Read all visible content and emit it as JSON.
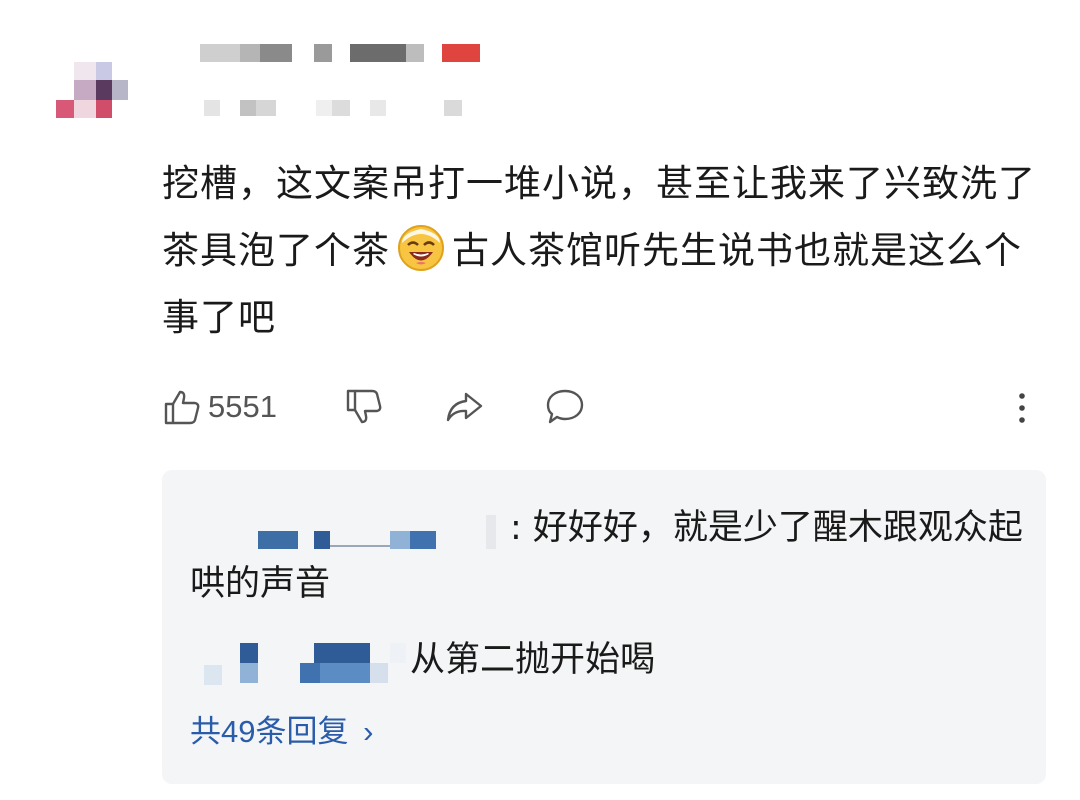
{
  "comment": {
    "text_before_emoji": "挖槽，这文案吊打一堆小说，甚至让我来了兴致洗了茶具泡了个茶",
    "emoji_icon": "laughing-face-emoji",
    "text_after_emoji": "古人茶馆听先生说书也就是这么个事了吧"
  },
  "actions": {
    "like_count": "5551",
    "icons": [
      "thumbs-up-icon",
      "thumbs-down-icon",
      "share-icon",
      "reply-bubble-icon",
      "more-dots-icon"
    ]
  },
  "replies": [
    {
      "separator": ": ",
      "text": "好好好，就是少了醒木跟观众起哄的声音"
    },
    {
      "text": "从第二抛开始喝"
    }
  ],
  "more_replies_label": "共49条回复",
  "more_replies_chevron": "›",
  "colors": {
    "link_blue": "#2a5caa",
    "reply_bg": "#f4f5f7"
  }
}
